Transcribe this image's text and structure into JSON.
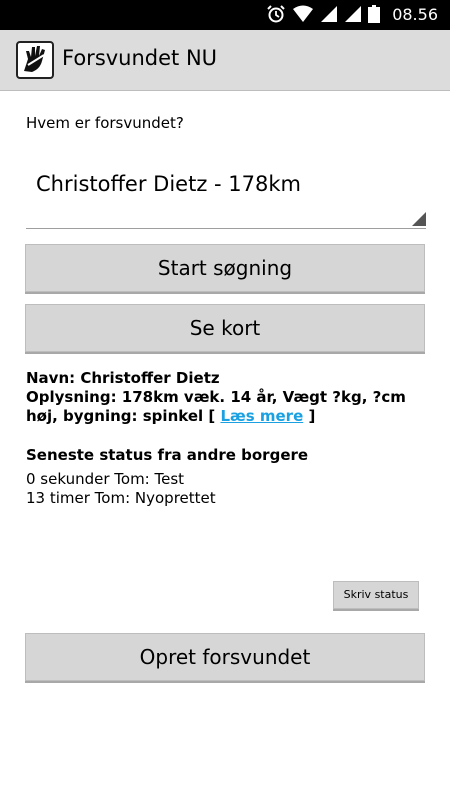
{
  "statusbar": {
    "time": "08.56"
  },
  "actionbar": {
    "title": "Forsvundet NU"
  },
  "form": {
    "who_label": "Hvem er forsvundet?",
    "selected_person": "Christoffer Dietz - 178km"
  },
  "buttons": {
    "start_search": "Start søgning",
    "see_map": "Se kort",
    "write_status": "Skriv status",
    "create_missing": "Opret forsvundet"
  },
  "info": {
    "name_line": "Navn: Christoffer Dietz",
    "details_line": "Oplysning: 178km væk. 14 år, Vægt ?kg, ?cm høj, bygning: spinkel [",
    "read_more": "Læs mere",
    "close_bracket": " ]"
  },
  "latest_status": {
    "title": "Seneste status fra andre borgere",
    "entries": [
      "0 sekunder Tom: Test",
      "13 timer Tom: Nyoprettet"
    ]
  }
}
